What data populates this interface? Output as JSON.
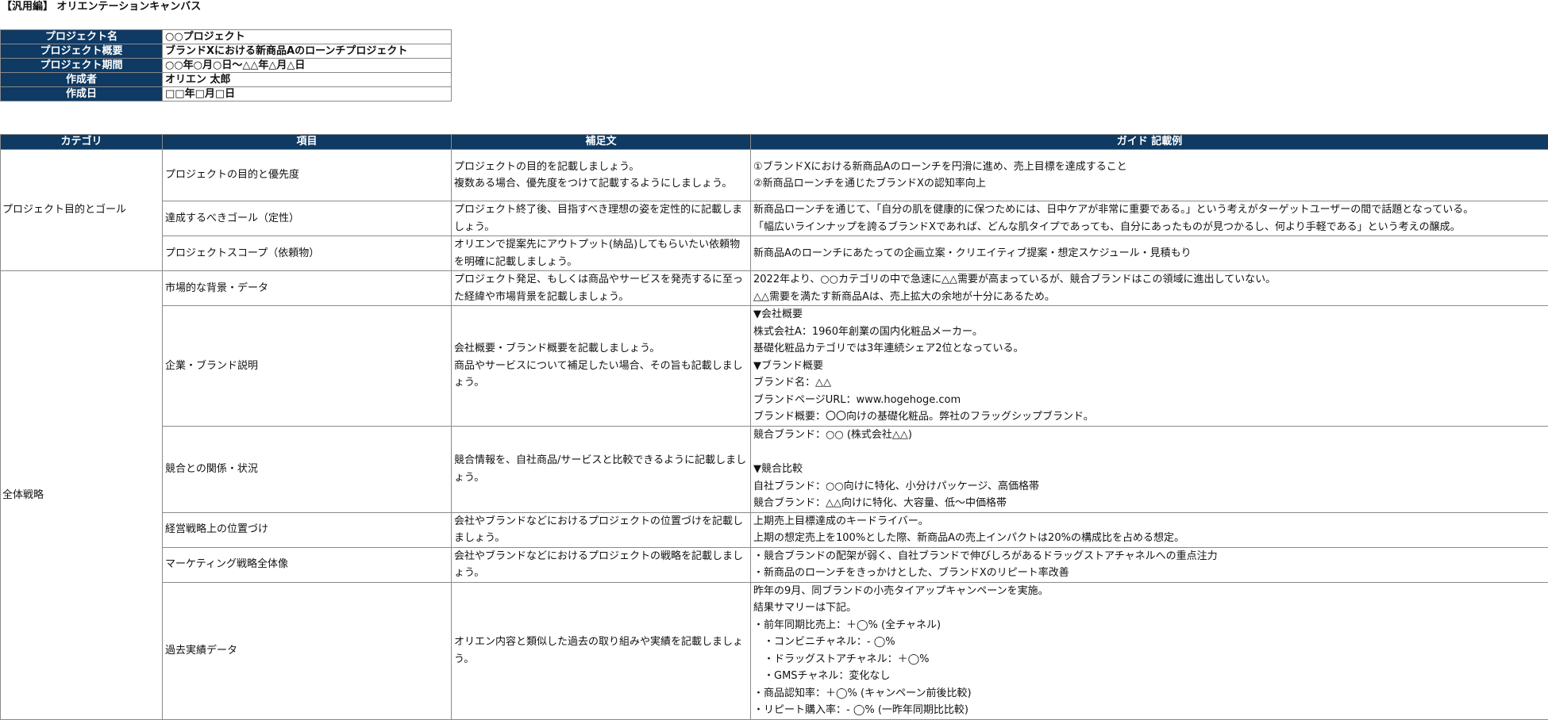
{
  "title": "【汎用編】 オリエンテーションキャンバス",
  "info": {
    "rows": [
      {
        "key": "プロジェクト名",
        "value": "○○プロジェクト"
      },
      {
        "key": "プロジェクト概要",
        "value": "ブランドXにおける新商品Aのローンチプロジェクト"
      },
      {
        "key": "プロジェクト期間",
        "value": "○○年○月○日～△△年△月△日"
      },
      {
        "key": "作成者",
        "value": "オリエン 太郎"
      },
      {
        "key": "作成日",
        "value": "□□年□月□日"
      }
    ]
  },
  "table": {
    "headers": [
      "カテゴリ",
      "項目",
      "補足文",
      "ガイド 記載例"
    ],
    "categories": {
      "goal": "プロジェクト目的とゴール",
      "strategy": "全体戦略"
    },
    "rows": [
      {
        "item": "プロジェクトの目的と優先度",
        "note": "プロジェクトの目的を記載しましょう。\n複数ある場合、優先度をつけて記載するようにしましょう。",
        "guide": "①ブランドXにおける新商品Aのローンチを円滑に進め、売上目標を達成すること\n②新商品ローンチを通じたブランドXの認知率向上"
      },
      {
        "item": "達成するべきゴール（定性）",
        "note": "プロジェクト終了後、目指すべき理想の姿を定性的に記載しましょう。",
        "guide": "新商品ローンチを通じて、「自分の肌を健康的に保つためには、日中ケアが非常に重要である。」という考えがターゲットユーザーの間で話題となっている。\n「幅広いラインナップを誇るブランドXであれば、どんな肌タイプであっても、自分にあったものが見つかるし、何より手軽である」という考えの醸成。"
      },
      {
        "item": "プロジェクトスコープ（依頼物）",
        "note": "オリエンで提案先にアウトプット(納品)してもらいたい依頼物を明確に記載しましょう。",
        "guide": "新商品Aのローンチにあたっての企画立案・クリエイティブ提案・想定スケジュール・見積もり"
      },
      {
        "item": "市場的な背景・データ",
        "note": "プロジェクト発足、もしくは商品やサービスを発売するに至った経緯や市場背景を記載しましょう。",
        "guide": "2022年より、○○カテゴリの中で急速に△△需要が高まっているが、競合ブランドはこの領域に進出していない。\n△△需要を満たす新商品Aは、売上拡大の余地が十分にあるため。"
      },
      {
        "item": "企業・ブランド説明",
        "note": "会社概要・ブランド概要を記載しましょう。\n商品やサービスについて補足したい場合、その旨も記載しましょう。",
        "guide": "▼会社概要\n株式会社A：1960年創業の国内化粧品メーカー。\n基礎化粧品カテゴリでは3年連続シェア2位となっている。\n▼ブランド概要\nブランド名：△△\nブランドページURL：www.hogehoge.com\nブランド概要：〇〇向けの基礎化粧品。弊社のフラッグシップブランド。"
      },
      {
        "item": "競合との関係・状況",
        "note": "競合情報を、自社商品/サービスと比較できるように記載しましょう。",
        "guide": "競合ブランド：○○ (株式会社△△)\n\n▼競合比較\n自社ブランド：○○向けに特化、小分けパッケージ、高価格帯\n競合ブランド：△△向けに特化、大容量、低～中価格帯"
      },
      {
        "item": "経営戦略上の位置づけ",
        "note": "会社やブランドなどにおけるプロジェクトの位置づけを記載しましょう。",
        "guide": "上期売上目標達成のキードライバー。\n上期の想定売上を100%とした際、新商品Aの売上インパクトは20%の構成比を占める想定。"
      },
      {
        "item": "マーケティング戦略全体像",
        "note": "会社やブランドなどにおけるプロジェクトの戦略を記載しましょう。",
        "guide": "・競合ブランドの配架が弱く、自社ブランドで伸びしろがあるドラッグストアチャネルへの重点注力\n・新商品のローンチをきっかけとした、ブランドXのリピート率改善"
      },
      {
        "item": "過去実績データ",
        "note": "オリエン内容と類似した過去の取り組みや実績を記載しましょう。",
        "guide": "昨年の9月、同ブランドの小売タイアップキャンペーンを実施。\n結果サマリーは下記。\n・前年同期比売上：＋◯% (全チャネル)\n　・コンビニチャネル：- ◯%\n　・ドラッグストアチャネル：＋◯%\n　・GMSチャネル：変化なし\n・商品認知率：＋◯% (キャンペーン前後比較)\n・リピート購入率：- ◯% (一昨年同期比比較)"
      }
    ]
  }
}
